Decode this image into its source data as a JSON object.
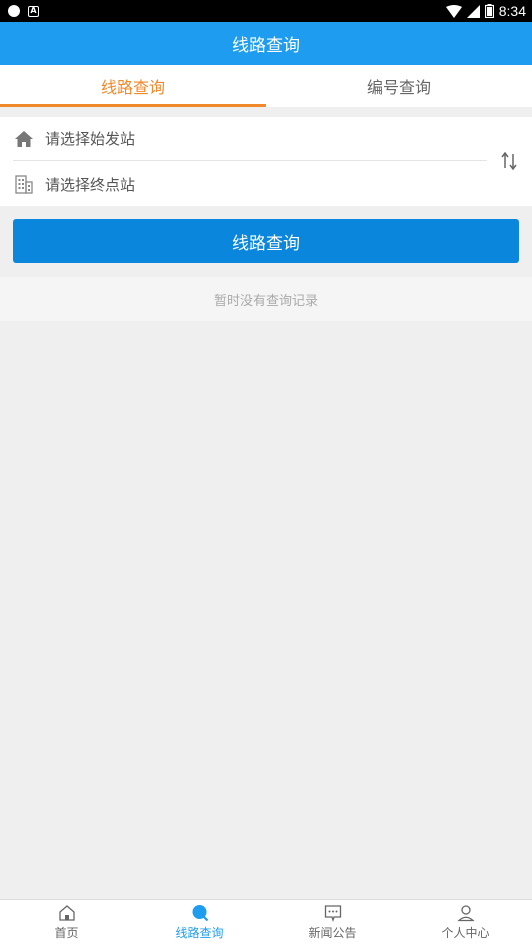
{
  "status_bar": {
    "time": "8:34"
  },
  "header": {
    "title": "线路查询"
  },
  "tabs": [
    {
      "label": "线路查询",
      "active": true
    },
    {
      "label": "编号查询",
      "active": false
    }
  ],
  "stations": {
    "start_placeholder": "请选择始发站",
    "end_placeholder": "请选择终点站"
  },
  "query_button": {
    "label": "线路查询"
  },
  "history": {
    "empty_text": "暂时没有查询记录"
  },
  "bottom_nav": [
    {
      "label": "首页",
      "icon": "home-icon",
      "active": false
    },
    {
      "label": "线路查询",
      "icon": "search-icon",
      "active": true
    },
    {
      "label": "新闻公告",
      "icon": "message-icon",
      "active": false
    },
    {
      "label": "个人中心",
      "icon": "user-icon",
      "active": false
    }
  ],
  "colors": {
    "primary": "#1e9cf0",
    "button": "#0a87dc",
    "tab_active": "#f0892a",
    "background": "#efefef"
  }
}
